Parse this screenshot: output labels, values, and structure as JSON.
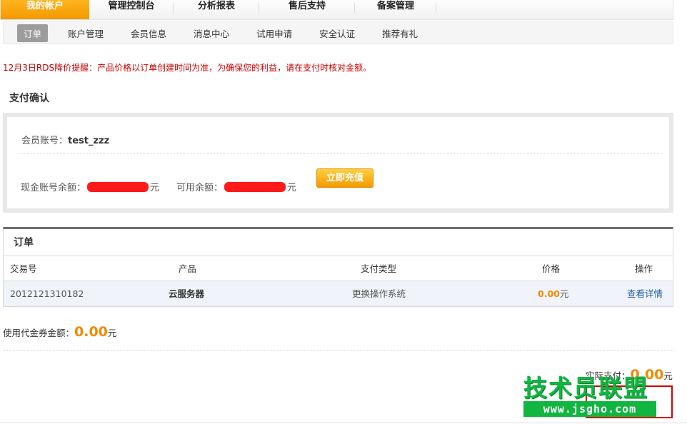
{
  "topnav": {
    "tabs": [
      {
        "label": "我的帐户",
        "active": true
      },
      {
        "label": "管理控制台"
      },
      {
        "label": "分析报表"
      },
      {
        "label": "售后支持"
      },
      {
        "label": "备案管理"
      }
    ]
  },
  "subnav": {
    "items": [
      {
        "label": "订单",
        "active": true
      },
      {
        "label": "账户管理"
      },
      {
        "label": "会员信息"
      },
      {
        "label": "消息中心"
      },
      {
        "label": "试用申请"
      },
      {
        "label": "安全认证"
      },
      {
        "label": "推荐有礼"
      }
    ]
  },
  "notice": "12月3日RDS降价提醒：产品价格以订单创建时间为准，为确保您的利益，请在支付时核对金额。",
  "pay_title": "支付确认",
  "account": {
    "member_label": "会员账号：",
    "member_value": "test_zzz",
    "cash_label": "现金账号余额：",
    "cash_value": "",
    "unit": "元",
    "available_label": "可用余额：",
    "available_value": "",
    "recharge_button": "立即充值"
  },
  "orders": {
    "title": "订单",
    "columns": [
      "交易号",
      "产品",
      "支付类型",
      "价格",
      "操作"
    ],
    "rows": [
      {
        "id": "2012121310182",
        "product": "云服务器",
        "pay_type": "更换操作系统",
        "price": "0.00",
        "unit": "元",
        "action": "查看详情"
      }
    ]
  },
  "coupon": {
    "label": "使用代金券金额：",
    "amount": "0.00",
    "unit": "元"
  },
  "paid": {
    "label": "实际支付：",
    "amount": "0.00",
    "unit": "元"
  },
  "watermark": {
    "top": "技术员联盟",
    "bottom": "www.jsgho.com"
  },
  "colors": {
    "accent": "#f29a00",
    "price": "#f08a00",
    "notice": "#cc0000",
    "link": "#1f5ea8",
    "watermark": "#11b640"
  }
}
